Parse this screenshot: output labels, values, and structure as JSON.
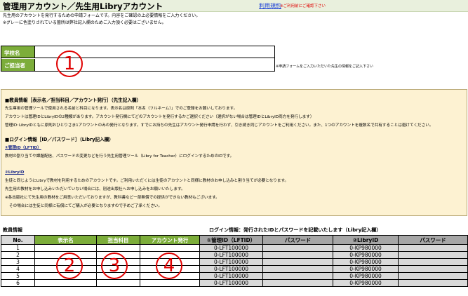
{
  "header": {
    "title": "管理用アカウント／先生用Libryアカウント",
    "terms_link": "利用規約",
    "terms_note": "※ご利用前にご確認下さい"
  },
  "intro": {
    "line1": "先生用のアカウントを発行するための申請フォームです。内容をご確認の上必要情報をご入力ください。",
    "line2": "※グレーに色塗りされている箇所は弊社記入欄のためご入力頂く必要はございません。"
  },
  "form": {
    "school_label": "学校名",
    "teacher_label": "ご担当者",
    "school_value": "",
    "teacher_value": "",
    "side_note": "※申請フォームをご入力いただいた先生の情報をご記入下さい"
  },
  "markers": [
    "1",
    "2",
    "3",
    "4"
  ],
  "info": {
    "heading1": "■教員情報［表示名／担当科目／アカウント発行］（先生記入欄）",
    "p1": "先生専用の管理ツールで使用される名前と科目になります。表示名は原則「本名（フルネーム）」でのご登録をお願いしております。",
    "p2": "アカウントは管理IDとLibryIDの2種類があります。アカウント発行欄にてどのアカウントを発行するかご選択ください（選択がない場合は管理IDとLibryID両方を発行します）",
    "p3": "管理ID･LibryIDともに原則おひとりさま1アカウントのみの発行となります。すでにお持ちの先生はアカウント発行申請を行わず、引き続き同じアカウントをご利用ください。また、1つのアカウントを複数名で共有することは避けてください。",
    "heading2": "■ログイン情報［ID／パスワード］（Libry記入欄）",
    "sub1": "①管理ID（LFTID）",
    "sub1_desc": "教材の割り当てや課題配信、パスワードの変更などを行う先生用管理ツール（Libry for Teacher）にログインするためのIDです。",
    "sub2": "②LibryID",
    "sub2_desc1": "生徒と同じようにLibryで教材を利用するためのアカウントです。ご利用いただくには生徒のアカウントと同様に教材のお申し込みと割り当てが必要となります。",
    "sub2_desc2": "先生用の教材をお申し込みいただいていない場合には、別途出版社へお申し込みをお願いいたします。",
    "sub2_desc3": "※各出版社にて先生用の教材をご用意いただいておりますが、教科書など一部無償での提供ができない教材もございます。",
    "sub2_desc4": "その場合には生徒と同様に有償にてご購入が必要となりますので予めご了承ください。"
  },
  "tables": {
    "staff_label": "教員情報",
    "login_label": "ログイン情報：発行されたIDとパスワードを記載いたします（Libry記入欄）",
    "headers": [
      "No.",
      "表示名",
      "担当科目",
      "アカウント発行",
      "①管理ID（LFTID）",
      "パスワード",
      "②LibryID",
      "パスワード"
    ],
    "rows": [
      {
        "no": "1",
        "lft": "0-LFT100000",
        "kp": "0-KP980000"
      },
      {
        "no": "2",
        "lft": "0-LFT100000",
        "kp": "0-KP980000"
      },
      {
        "no": "3",
        "lft": "0-LFT100000",
        "kp": "0-KP980000"
      },
      {
        "no": "4",
        "lft": "0-LFT100000",
        "kp": "0-KP980000"
      },
      {
        "no": "5",
        "lft": "0-LFT100000",
        "kp": "0-KP980000"
      },
      {
        "no": "6",
        "lft": "0-LFT100000",
        "kp": "0-KP980000"
      }
    ]
  },
  "colors": {
    "green": "#7cad3a",
    "gray": "#d9d9d9",
    "dark_gray": "#a6a6a6",
    "cream": "#fdf2d2",
    "red": "#e00000",
    "link_blue": "#1a3fd6"
  }
}
